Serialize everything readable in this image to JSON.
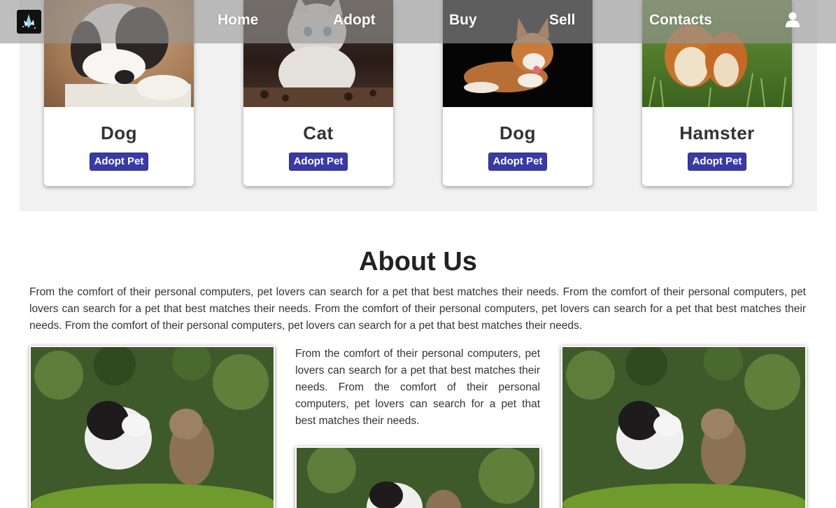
{
  "nav": {
    "links": [
      "Home",
      "Adopt",
      "Buy",
      "Sell",
      "Contacts"
    ],
    "user_icon": "user-icon",
    "logo_icon": "bird-logo-icon"
  },
  "pets": [
    {
      "name": "Dog",
      "button": "Adopt Pet"
    },
    {
      "name": "Cat",
      "button": "Adopt Pet"
    },
    {
      "name": "Dog",
      "button": "Adopt Pet"
    },
    {
      "name": "Hamster",
      "button": "Adopt Pet"
    }
  ],
  "about": {
    "title": "About Us",
    "paragraph": "From the comfort of their personal computers, pet lovers can search for a pet that best matches their needs. From the comfort of their personal computers, pet lovers can search for a pet that best matches their needs. From the comfort of their personal computers, pet lovers can search for a pet that best matches their needs. From the comfort of their personal computers, pet lovers can search for a pet that best matches their needs.",
    "side_paragraph": "From the comfort of their personal computers, pet lovers can search for a pet that best matches their needs. From the comfort of their personal computers, pet lovers can search for a pet that best matches their needs."
  },
  "colors": {
    "button": "#3a3aa6",
    "section_bg": "#f1f1f1",
    "nav_bg": "#969696"
  }
}
